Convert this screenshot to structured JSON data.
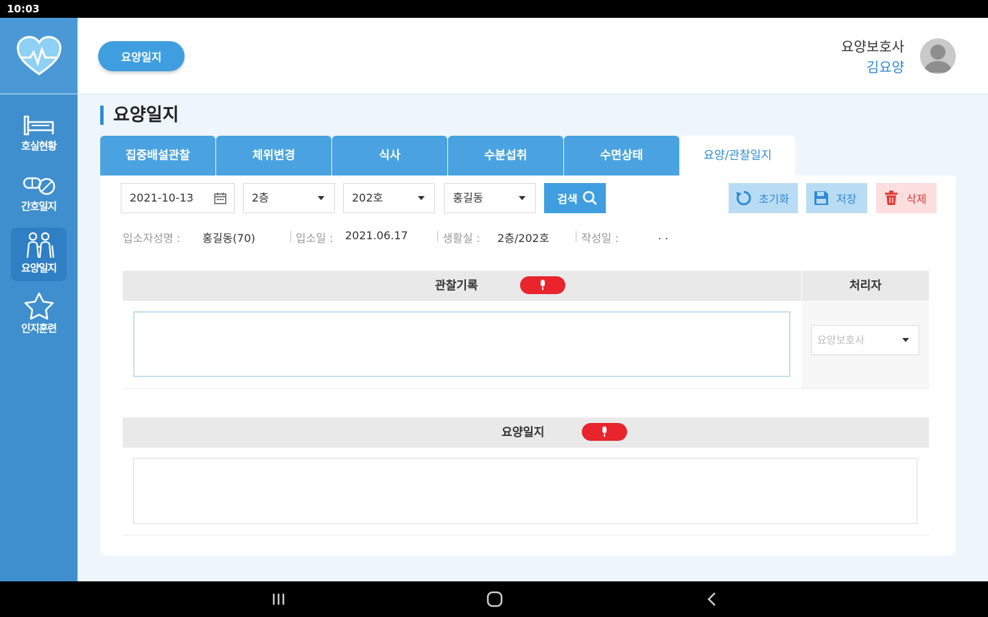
{
  "status_bar": {
    "time": "10:03"
  },
  "sidebar": {
    "items": [
      {
        "label": "호실현황",
        "icon": "bed-icon",
        "active": false
      },
      {
        "label": "간호일지",
        "icon": "pills-icon",
        "active": false
      },
      {
        "label": "요양일지",
        "icon": "caregiver-icon",
        "active": true
      },
      {
        "label": "인지훈련",
        "icon": "star-icon",
        "active": false
      }
    ]
  },
  "header": {
    "pill_label": "요양일지",
    "user_role": "요양보호사",
    "user_name": "김요양"
  },
  "page": {
    "title": "요양일지"
  },
  "tabs": [
    {
      "label": "집중배설관찰",
      "active": false
    },
    {
      "label": "체위변경",
      "active": false
    },
    {
      "label": "식사",
      "active": false
    },
    {
      "label": "수분섭취",
      "active": false
    },
    {
      "label": "수면상태",
      "active": false
    },
    {
      "label": "요양/관찰일지",
      "active": true
    }
  ],
  "filters": {
    "date": "2021-10-13",
    "floor": "2층",
    "room": "202호",
    "resident": "홍길동",
    "search_label": "검색"
  },
  "actions": {
    "reset_label": "초기화",
    "save_label": "저장",
    "delete_label": "삭제"
  },
  "info": {
    "resident_name_label": "입소자성명 :",
    "resident_name_value": "홍길동(70)",
    "admission_label": "입소일 :",
    "admission_value": "2021.06.17",
    "room_label": "생활실 :",
    "room_value": "2층/202호",
    "written_label": "작성일 :",
    "written_value": ". ."
  },
  "observation": {
    "header": "관찰기록",
    "handler_header": "처리자",
    "handler_placeholder": "요양보호사",
    "text": ""
  },
  "care_log": {
    "header": "요양일지",
    "text": ""
  },
  "colors": {
    "sidebar": "#3f8fce",
    "accent": "#3f9ee0",
    "mic": "#e8242c",
    "delete": "#e23b3b"
  }
}
